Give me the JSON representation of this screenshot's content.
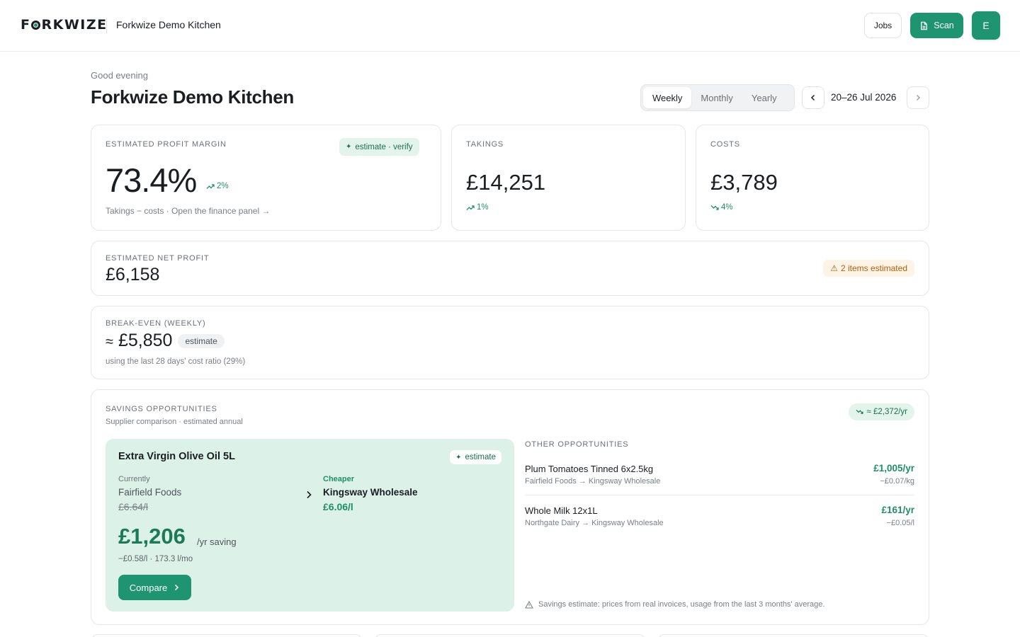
{
  "header": {
    "logo_text": "FORKWIZE",
    "kitchen_name": "Forkwize Demo Kitchen",
    "jobs_label": "Jobs",
    "scan_label": "Scan",
    "avatar_initial": "E"
  },
  "page": {
    "greeting": "Good evening",
    "title": "Forkwize Demo Kitchen",
    "periods": [
      "Weekly",
      "Monthly",
      "Yearly"
    ],
    "active_period": "Weekly",
    "date_range": "20–26 Jul 2026"
  },
  "margin_card": {
    "label": "ESTIMATED PROFIT MARGIN",
    "badge": "estimate · verify",
    "value": "73.4%",
    "trend": "2%",
    "note": "Takings − costs · Open the finance panel →"
  },
  "takings_card": {
    "label": "TAKINGS",
    "value": "£14,251",
    "trend": "1%"
  },
  "costs_card": {
    "label": "COSTS",
    "value": "£3,789",
    "trend": "4%"
  },
  "net_profit_card": {
    "label": "ESTIMATED NET PROFIT",
    "value": "£6,158",
    "warning": "2 items estimated"
  },
  "break_even_card": {
    "label": "BREAK-EVEN (WEEKLY)",
    "prefix": "≈",
    "value": "£5,850",
    "tag": "estimate",
    "note": "using the last 28 days' cost ratio (29%)"
  },
  "savings_card": {
    "label": "SAVINGS OPPORTUNITIES",
    "subtitle": "Supplier comparison · estimated annual",
    "total": "≈ £2,372/yr",
    "featured": {
      "product": "Extra Virgin Olive Oil 5L",
      "tag": "estimate",
      "current_label": "Currently",
      "current_supplier": "Fairfield Foods",
      "current_price": "£6.64/l",
      "new_label": "Cheaper",
      "new_supplier": "Kingsway Wholesale",
      "new_price": "£6.06/l",
      "saving": "£1,206",
      "saving_unit": "/yr saving",
      "detail": "−£0.58/l · 173.3 l/mo",
      "compare_label": "Compare"
    },
    "other_label": "OTHER OPPORTUNITIES",
    "others": [
      {
        "product": "Plum Tomatoes Tinned 6x2.5kg",
        "route": "Fairfield Foods → Kingsway Wholesale",
        "amount": "£1,005/yr",
        "unit_saving": "−£0.07/kg"
      },
      {
        "product": "Whole Milk 12x1L",
        "route": "Northgate Dairy → Kingsway Wholesale",
        "amount": "£161/yr",
        "unit_saving": "−£0.05/l"
      }
    ],
    "footnote": "Savings estimate: prices from real invoices, usage from the last 3 months' average."
  },
  "colors": {
    "accent": "#1f9470",
    "accent_text": "#1f8f68",
    "feature_bg": "#dcf2e8",
    "warning": "#b35c0a"
  }
}
